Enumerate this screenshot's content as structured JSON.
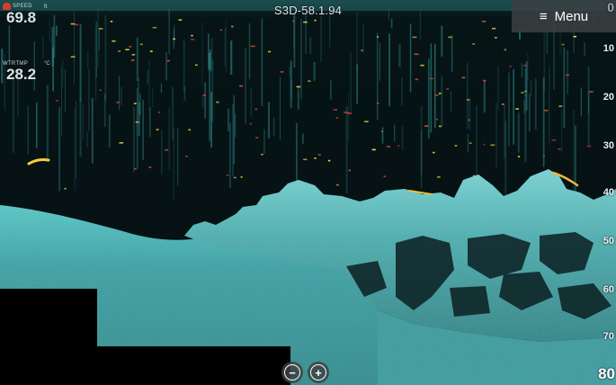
{
  "header": {
    "title": "S3D-58.1.94",
    "menu_label": "Menu",
    "menu_icon": "hamburger-icon"
  },
  "readouts": {
    "speed": {
      "label": "SPEED",
      "value": "69.8",
      "unit": "ft",
      "icon": "speed-icon"
    },
    "water_temp": {
      "label": "WTRTMP",
      "value": "28.2",
      "unit": "°C"
    }
  },
  "depth_scale": {
    "labels": [
      "0",
      "10",
      "20",
      "30",
      "40",
      "50",
      "60",
      "70"
    ],
    "max_label": "80"
  },
  "zoom": {
    "zoom_out_symbol": "−",
    "zoom_in_symbol": "+"
  },
  "colors": {
    "background": "#041012",
    "bottom_return": "#49b3b3",
    "fish_arch": "#e8c23a",
    "target": "#d8552a",
    "menu_bg": "#3a4042"
  }
}
